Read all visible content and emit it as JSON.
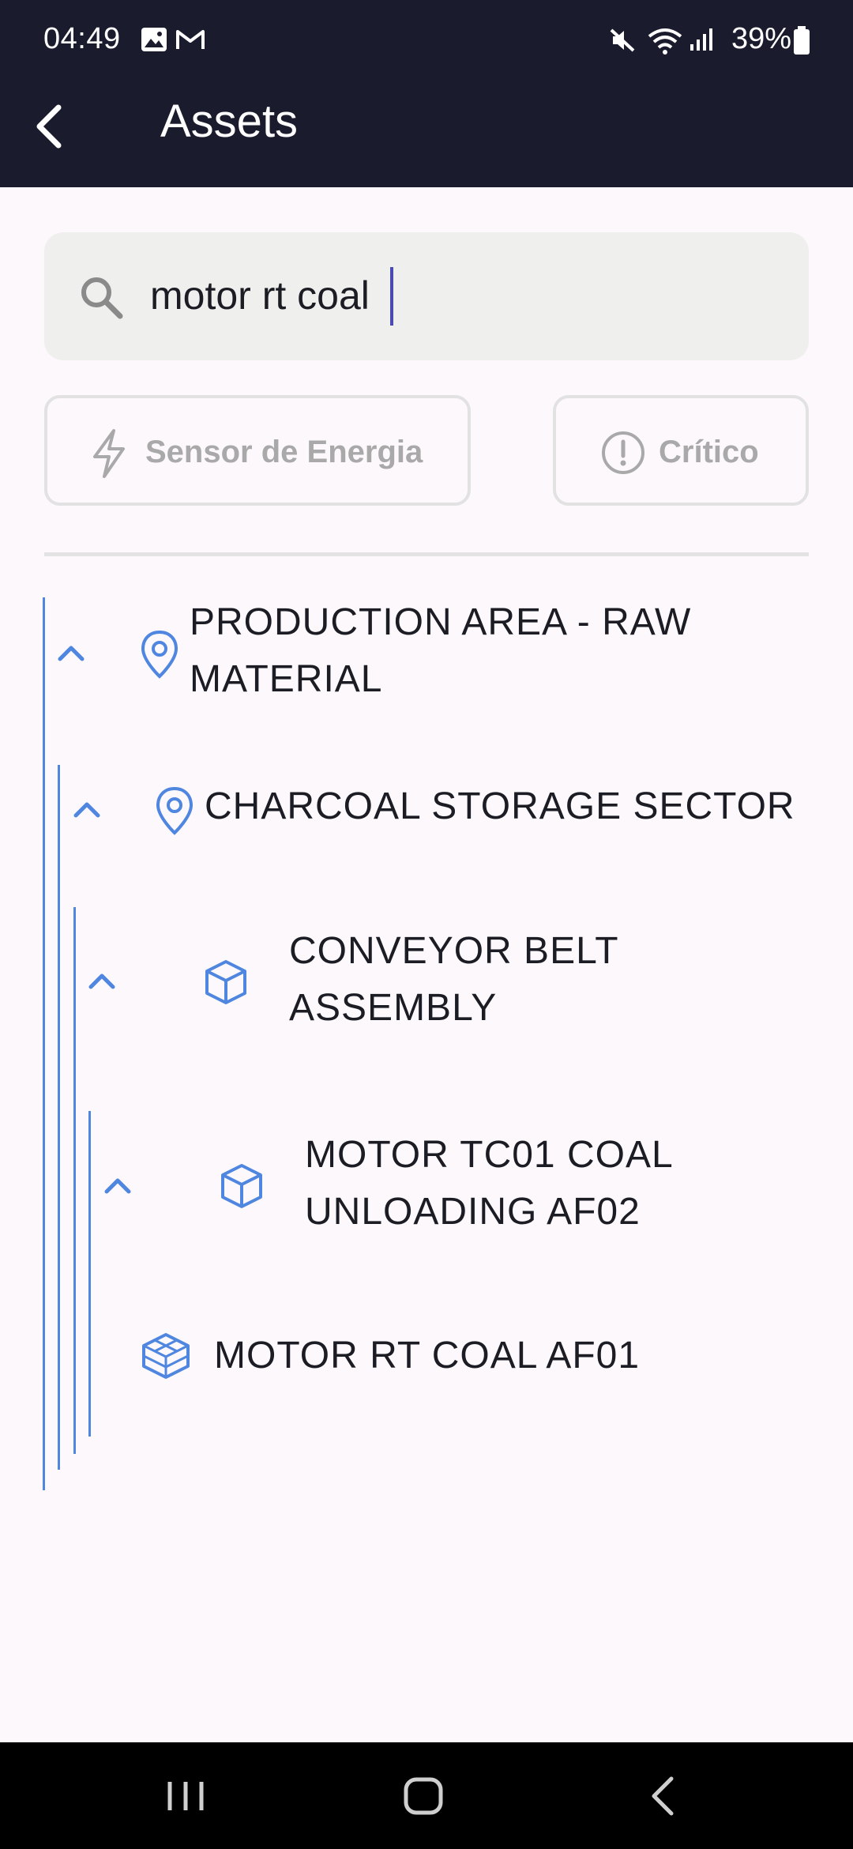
{
  "status_bar": {
    "time": "04:49",
    "battery": "39%"
  },
  "app_bar": {
    "title": "Assets"
  },
  "search": {
    "value": "motor rt coal"
  },
  "filters": {
    "energy_label": "Sensor de Energia",
    "critical_label": "Crítico"
  },
  "tree": [
    {
      "label": "PRODUCTION AREA - RAW MATERIAL",
      "icon": "location-pin-icon",
      "expanded": true
    },
    {
      "label": "CHARCOAL STORAGE SECTOR",
      "icon": "location-pin-icon",
      "expanded": true
    },
    {
      "label": "CONVEYOR BELT ASSEMBLY",
      "icon": "cube-icon",
      "expanded": true
    },
    {
      "label": "MOTOR TC01 COAL UNLOADING AF02",
      "icon": "cube-icon",
      "expanded": true
    },
    {
      "label": "MOTOR RT COAL AF01",
      "icon": "component-icon",
      "expanded": false
    }
  ],
  "colors": {
    "app_bar": "#1b1b2e",
    "accent": "#4f86e0",
    "background": "#fdf8fc",
    "chip_text": "#a9a9a9"
  }
}
